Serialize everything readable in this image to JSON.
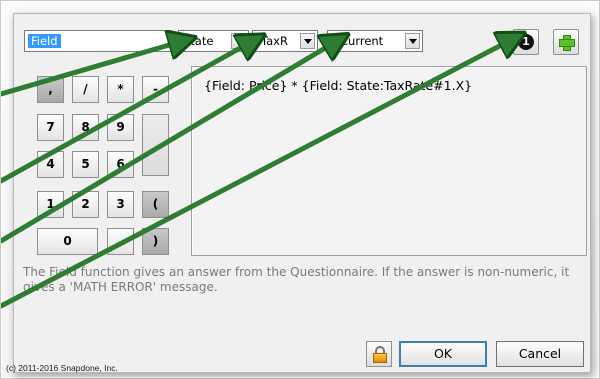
{
  "toolbar": {
    "field_value": "Field",
    "state_value": "State",
    "tax_value": "TaxR",
    "period_value": "Current",
    "info_icon_glyph": "1",
    "info_icon": "info-circle-icon",
    "add_icon": "green-plus-icon"
  },
  "keypad": {
    "keys": [
      ",",
      "/",
      "*",
      "-",
      "7",
      "8",
      "9",
      "4",
      "5",
      "6",
      "1",
      "2",
      "3",
      "(",
      "0",
      ".",
      ")"
    ]
  },
  "formula": {
    "text": "{Field: Price} * {Field: State:TaxRate#1.X}"
  },
  "help": {
    "text": "The Field function gives an answer from the Questionnaire.  If the answer is non-numeric, it gives a 'MATH ERROR' message."
  },
  "buttons": {
    "lock_icon": "padlock-icon",
    "ok_label": "OK",
    "cancel_label": "Cancel"
  },
  "footer": {
    "copyright": "(c) 2011-2016 Snapdone, Inc."
  },
  "colors": {
    "arrow": "#2e7d32",
    "selection": "#3399ff",
    "plus": "#5cbf2a"
  }
}
